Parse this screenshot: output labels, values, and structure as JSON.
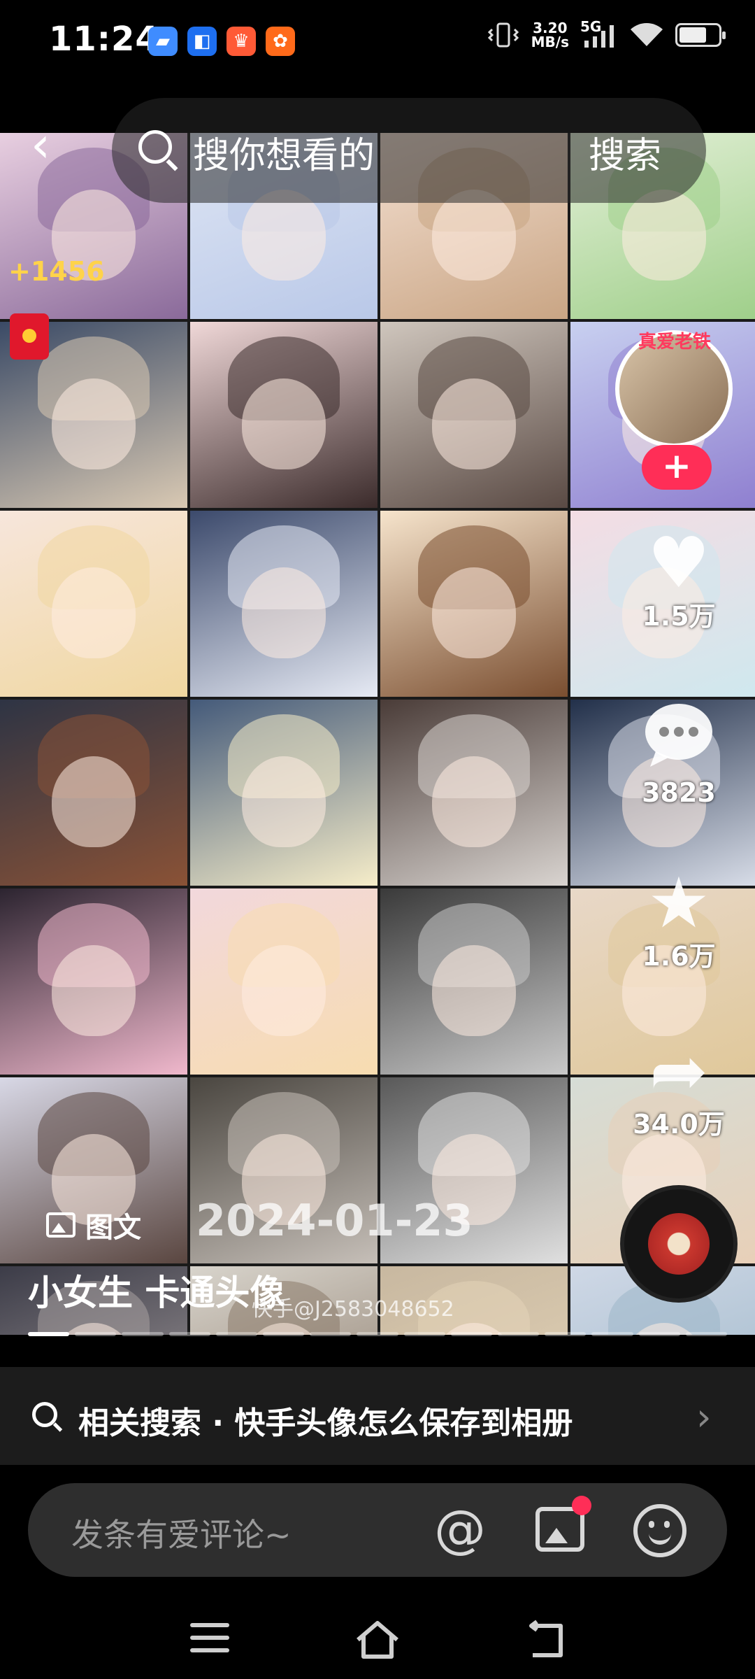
{
  "status_bar": {
    "time": "11:24",
    "speed_value": "3.20",
    "speed_unit": "MB/s",
    "network": "5G",
    "battery_level": 0.7,
    "notification_apps": [
      {
        "icon": "blue-folder-icon",
        "color": "#3f8cff",
        "glyph": "▰"
      },
      {
        "icon": "blue-square-app-icon",
        "color": "#1e6ff0",
        "glyph": "◧"
      },
      {
        "icon": "crown-app-icon",
        "color": "#ff5a36",
        "glyph": "♛"
      },
      {
        "icon": "orange-app-icon",
        "color": "#ff6a1a",
        "glyph": "✿"
      }
    ]
  },
  "search": {
    "placeholder": "搜你想看的",
    "button_label": "搜索"
  },
  "overlay": {
    "counter": "+1456"
  },
  "rail": {
    "avatar_badge": "真爱老铁",
    "follow_label": "+",
    "like_count": "1.5万",
    "comment_count": "3823",
    "collect_count": "1.6万",
    "share_count": "34.0万"
  },
  "post": {
    "type_label": "图文",
    "date": "2024-01-23",
    "caption": "小女生 卡通头像",
    "watermark": "快手@J2583048652",
    "pages": 15,
    "current_page": 1,
    "tile_palette": [
      [
        "#e8cfe0",
        "#8a6a9a"
      ],
      [
        "#dfe6f4",
        "#b9c8e8"
      ],
      [
        "#f4e0d2",
        "#c9a584"
      ],
      [
        "#e4f0d8",
        "#9fcf8a"
      ],
      [
        "#3a4a66",
        "#d9c9b3"
      ],
      [
        "#f0d8d8",
        "#3b2b2b"
      ],
      [
        "#cfc6bd",
        "#5a4a44"
      ],
      [
        "#c8d0f0",
        "#8f7fd0"
      ],
      [
        "#f7e6dc",
        "#f0d7a0"
      ],
      [
        "#3c4a6c",
        "#e6eaf4"
      ],
      [
        "#f6e4cc",
        "#7a4e30"
      ],
      [
        "#f4dde4",
        "#cfe8ee"
      ],
      [
        "#2e3444",
        "#8a5236"
      ],
      [
        "#445a7a",
        "#f6edc9"
      ],
      [
        "#4a3c38",
        "#d9d4d0"
      ],
      [
        "#22304a",
        "#d8dde8"
      ],
      [
        "#2c2430",
        "#f0b8cc"
      ],
      [
        "#f2d8dc",
        "#f7dcb0"
      ],
      [
        "#3a3a3a",
        "#c9c9c9"
      ],
      [
        "#e8d8c8",
        "#e0c89a"
      ],
      [
        "#d8d8e6",
        "#5a4640"
      ],
      [
        "#4a4640",
        "#c6bfb8"
      ],
      [
        "#595959",
        "#e0e0e0"
      ],
      [
        "#d6ddd6",
        "#e8d0b8"
      ],
      [
        "#3c3c48",
        "#a8a0a0"
      ],
      [
        "#d8d4cc",
        "#8b7a6a"
      ],
      [
        "#c8b8a0",
        "#e4d4b8"
      ],
      [
        "#cfd8e6",
        "#9cb6c8"
      ]
    ]
  },
  "related_search": {
    "text": "相关搜索 · 快手头像怎么保存到相册"
  },
  "comment_bar": {
    "placeholder": "发条有爱评论~",
    "at_symbol": "@"
  }
}
